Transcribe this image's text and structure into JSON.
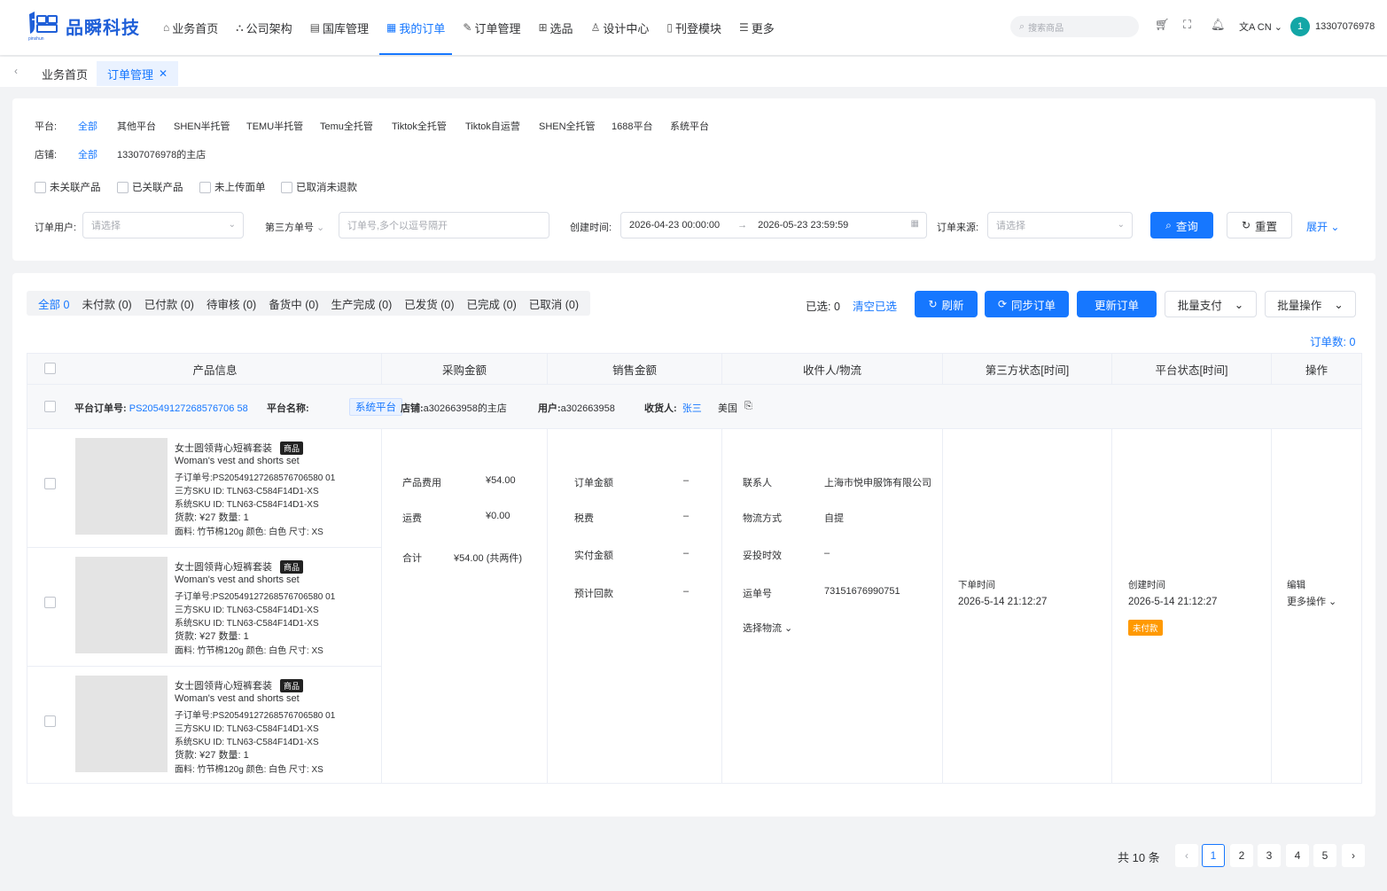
{
  "brand": {
    "name": "品瞬科技",
    "mark": "品瞬",
    "sub": "pinshun"
  },
  "nav": [
    {
      "label": "业务首页",
      "icon": "home-icon"
    },
    {
      "label": "公司架构",
      "icon": "org-icon"
    },
    {
      "label": "国库管理",
      "icon": "archive-icon"
    },
    {
      "label": "我的订单",
      "icon": "grid-icon",
      "active": true
    },
    {
      "label": "订单管理",
      "icon": "edit-icon"
    },
    {
      "label": "选品",
      "icon": "table-icon"
    },
    {
      "label": "设计中心",
      "icon": "design-icon"
    },
    {
      "label": "刊登模块",
      "icon": "doc-icon"
    },
    {
      "label": "更多",
      "icon": "menu-icon"
    }
  ],
  "header": {
    "search_placeholder": "搜索商品",
    "lang": "CN",
    "avatar_initial": "1",
    "phone": "13307076978"
  },
  "tabs": {
    "home": "业务首页",
    "current": "订单管理"
  },
  "filters": {
    "platform_label": "平台:",
    "platforms": [
      "全部",
      "其他平台",
      "SHEN半托管",
      "TEMU半托管",
      "Temu全托管",
      "Tiktok全托管",
      "Tiktok自运营",
      "SHEN全托管",
      "1688平台",
      "系统平台"
    ],
    "store_label": "店铺:",
    "stores": [
      "全部",
      "13307076978的主店"
    ],
    "checks": [
      "未关联产品",
      "已关联产品",
      "未上传面单",
      "已取消未退款"
    ],
    "user_label": "订单用户:",
    "user_placeholder": "请选择",
    "third_label": "第三方单号",
    "third_placeholder": "订单号,多个以逗号隔开",
    "time_label": "创建时间:",
    "time_start": "2026-04-23 00:00:00",
    "time_end": "2026-05-23 23:59:59",
    "source_label": "订单来源:",
    "source_placeholder": "请选择",
    "query": "查询",
    "reset": "重置",
    "expand": "展开"
  },
  "status_tabs": [
    "全部 0",
    "未付款 (0)",
    "已付款 (0)",
    "待审核 (0)",
    "备货中 (0)",
    "生产完成 (0)",
    "已发货 (0)",
    "已完成 (0)",
    "已取消 (0)"
  ],
  "toolbar": {
    "selected": "已选: 0",
    "clear": "清空已选",
    "refresh": "刷新",
    "sync": "同步订单",
    "update": "更新订单",
    "batch_pay": "批量支付",
    "batch_ops": "批量操作",
    "order_count": "订单数: 0"
  },
  "table": {
    "headers": [
      "产品信息",
      "采购金额",
      "销售金额",
      "收件人/物流",
      "第三方状态[时间]",
      "平台状态[时间]",
      "操作"
    ]
  },
  "order": {
    "no_label": "平台订单号:",
    "no": "PS20549127268576706 58",
    "platform_label": "平台名称:",
    "platform": "系统平台",
    "store_label": "店铺:",
    "store": "a302663958的主店",
    "user_label": "用户:",
    "user": "a302663958",
    "receiver_label": "收货人:",
    "receiver": "张三",
    "country": "美国",
    "items": [
      {
        "name": "女士圆领背心短裤套装",
        "badge": "商品",
        "en": "Woman's vest and shorts set",
        "sub_order": "子订单号:PS20549127268576706580 01",
        "sku3": "三方SKU ID:  TLN63-C584F14D1-XS",
        "skusys": "系统SKU ID:  TLN63-C584F14D1-XS",
        "price": "货款: ¥27    数量: 1",
        "attrs": "面料: 竹节棉120g    颜色: 白色    尺寸: XS"
      },
      {
        "name": "女士圆领背心短裤套装",
        "badge": "商品",
        "en": "Woman's vest and shorts set",
        "sub_order": "子订单号:PS20549127268576706580 01",
        "sku3": "三方SKU ID:  TLN63-C584F14D1-XS",
        "skusys": "系统SKU ID:  TLN63-C584F14D1-XS",
        "price": "货款: ¥27    数量: 1",
        "attrs": "面料: 竹节棉120g    颜色: 白色    尺寸: XS"
      },
      {
        "name": "女士圆领背心短裤套装",
        "badge": "商品",
        "en": "Woman's vest and shorts set",
        "sub_order": "子订单号:PS20549127268576706580 01",
        "sku3": "三方SKU ID:  TLN63-C584F14D1-XS",
        "skusys": "系统SKU ID:  TLN63-C584F14D1-XS",
        "price": "货款: ¥27    数量: 1",
        "attrs": "面料: 竹节棉120g    颜色: 白色    尺寸: XS"
      }
    ],
    "purchase": [
      {
        "k": "产品费用",
        "v": "¥54.00"
      },
      {
        "k": "运费",
        "v": "¥0.00"
      },
      {
        "k": "合计",
        "v": "¥54.00 (共两件)"
      }
    ],
    "sales": [
      {
        "k": "订单金额",
        "v": "–"
      },
      {
        "k": "税费",
        "v": "–"
      },
      {
        "k": "实付金额",
        "v": "–"
      },
      {
        "k": "预计回款",
        "v": "–"
      }
    ],
    "logistics": [
      {
        "k": "联系人",
        "v": "上海市悦申服饰有限公司"
      },
      {
        "k": "物流方式",
        "v": "自提"
      },
      {
        "k": "妥投时效",
        "v": "–"
      },
      {
        "k": "运单号",
        "v": "73151676990751"
      }
    ],
    "choose_logistics": "选择物流",
    "third_status_label": "下单时间",
    "third_status_time": "2026-5-14   21:12:27",
    "platform_status_label": "创建时间",
    "platform_status_time": "2026-5-14   21:12:27",
    "status_tag": "未付款",
    "edit": "编辑",
    "more": "更多操作"
  },
  "pagination": {
    "total": "共 10 条",
    "pages": [
      "1",
      "2",
      "3",
      "4",
      "5"
    ],
    "current": "1"
  },
  "colors": {
    "primary": "#1677ff",
    "warning": "#ff9900",
    "teal": "#13a6a6"
  }
}
